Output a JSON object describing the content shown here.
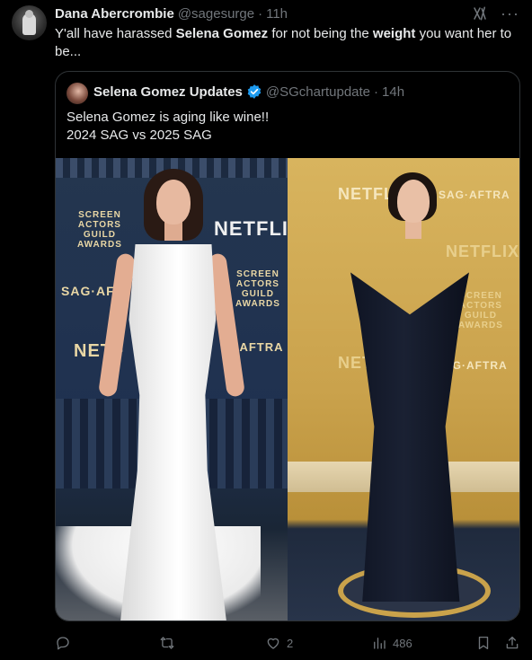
{
  "tweet": {
    "author_name": "Dana Abercrombie",
    "author_handle": "@sagesurge",
    "separator": "·",
    "time": "11h",
    "text_parts": {
      "p1": "Y'all have harassed ",
      "b1": "Selena Gomez",
      "p2": " for not being the ",
      "b2": "weight",
      "p3": " you want her to be..."
    }
  },
  "quote": {
    "author_name": "Selena Gomez Updates",
    "author_handle": "@SGchartupdate",
    "separator": "·",
    "time": "14h",
    "line1": "Selena Gomez is aging like wine!!",
    "line2": "2024 SAG vs 2025 SAG"
  },
  "media": {
    "left_backdrop": {
      "netflix": "NETFLIX",
      "sag": "SAG·AF",
      "netflix2": "NETF",
      "aftra": "G·AFTRA",
      "logo": "SCREEN\nACTORS\nGUILD\nAWARDS",
      "logo2": "SCREEN\nACTORS\nGUILD\nAWARDS"
    },
    "right_backdrop": {
      "netflix": "NETFL",
      "aftra": "SAG·AFTRA",
      "netflix2": "NETFLIX",
      "netflix3": "NET",
      "aftra2": "AG·AFTRA",
      "logo": "SCREEN\nACTORS\nGUILD\nAWARDS"
    }
  },
  "actions": {
    "reply_count": "",
    "retweet_count": "",
    "like_count": "2",
    "views_count": "486"
  },
  "colors": {
    "background": "#000000",
    "text": "#e7e9ea",
    "muted": "#71767b",
    "verified": "#1d9bf0",
    "border": "#2f3336"
  }
}
